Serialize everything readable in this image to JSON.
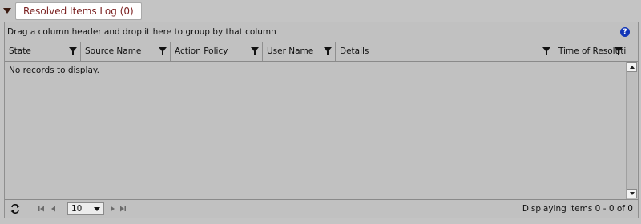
{
  "section": {
    "title": "Resolved Items Log (0)"
  },
  "grid": {
    "group_hint": "Drag a column header and drop it here to group by that column",
    "help_glyph": "?",
    "columns": [
      {
        "label": "State"
      },
      {
        "label": "Source Name"
      },
      {
        "label": "Action Policy"
      },
      {
        "label": "User Name"
      },
      {
        "label": "Details"
      },
      {
        "label": "Time of Resolution"
      }
    ],
    "empty_message": "No records to display."
  },
  "pager": {
    "page_size": "10",
    "info": "Displaying items 0 - 0 of 0"
  },
  "colors": {
    "background": "#c4c4c4",
    "title_text": "#7a1f1f",
    "help_icon": "#1236b8"
  }
}
